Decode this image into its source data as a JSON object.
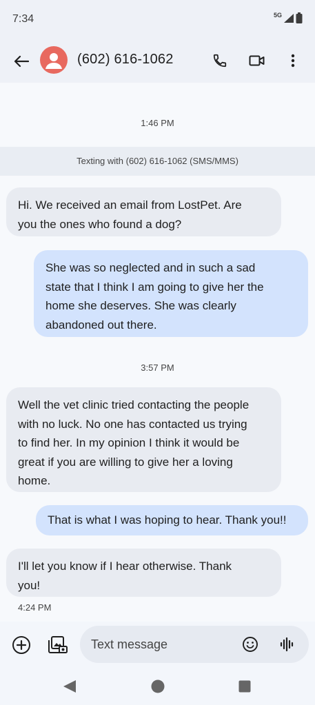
{
  "status_bar": {
    "time": "7:34",
    "network": "5G",
    "icons": [
      "signal-icon",
      "battery-icon"
    ]
  },
  "app_bar": {
    "contact_name": "(602) 616-1062",
    "avatar_color": "#e8695f",
    "icons": [
      "back-arrow-icon",
      "phone-icon",
      "video-call-icon",
      "more-vert-icon"
    ]
  },
  "conversation": {
    "timestamp_1": "1:46 PM",
    "banner": "Texting with (602) 616-1062 (SMS/MMS)",
    "timestamp_2": "3:57 PM",
    "messages": [
      {
        "direction": "incoming",
        "lines": [
          "Hi. We received an email from LostPet. Are",
          "you the ones who found a dog?"
        ]
      },
      {
        "direction": "outgoing",
        "lines": [
          "She was so neglected and in such a sad",
          "state that I think I am going to give her the",
          "home she deserves. She was clearly",
          "abandoned out there."
        ]
      },
      {
        "direction": "incoming",
        "lines": [
          "Well the vet clinic tried contacting the people",
          "with no luck. No one has contacted us trying",
          "to find her. In my opinion I think it would be",
          "great if you are willing to give her a loving",
          "home."
        ]
      },
      {
        "direction": "outgoing",
        "lines": [
          "That is what I was hoping to hear. Thank you!!"
        ]
      },
      {
        "direction": "incoming",
        "lines": [
          "I'll let you know if I hear otherwise. Thank",
          "you!"
        ]
      }
    ],
    "last_sent_time": "4:24 PM"
  },
  "composer": {
    "placeholder": "Text message",
    "value": "",
    "icons": [
      "add-icon",
      "gallery-icon",
      "emoji-icon",
      "voice-icon"
    ]
  },
  "nav_bar": {
    "icons": [
      "nav-back-icon",
      "nav-home-icon",
      "nav-recents-icon"
    ]
  },
  "colors": {
    "incoming_bubble": "#e8ebf1",
    "outgoing_bubble": "#d3e3fd",
    "background": "#f7f9fc"
  }
}
